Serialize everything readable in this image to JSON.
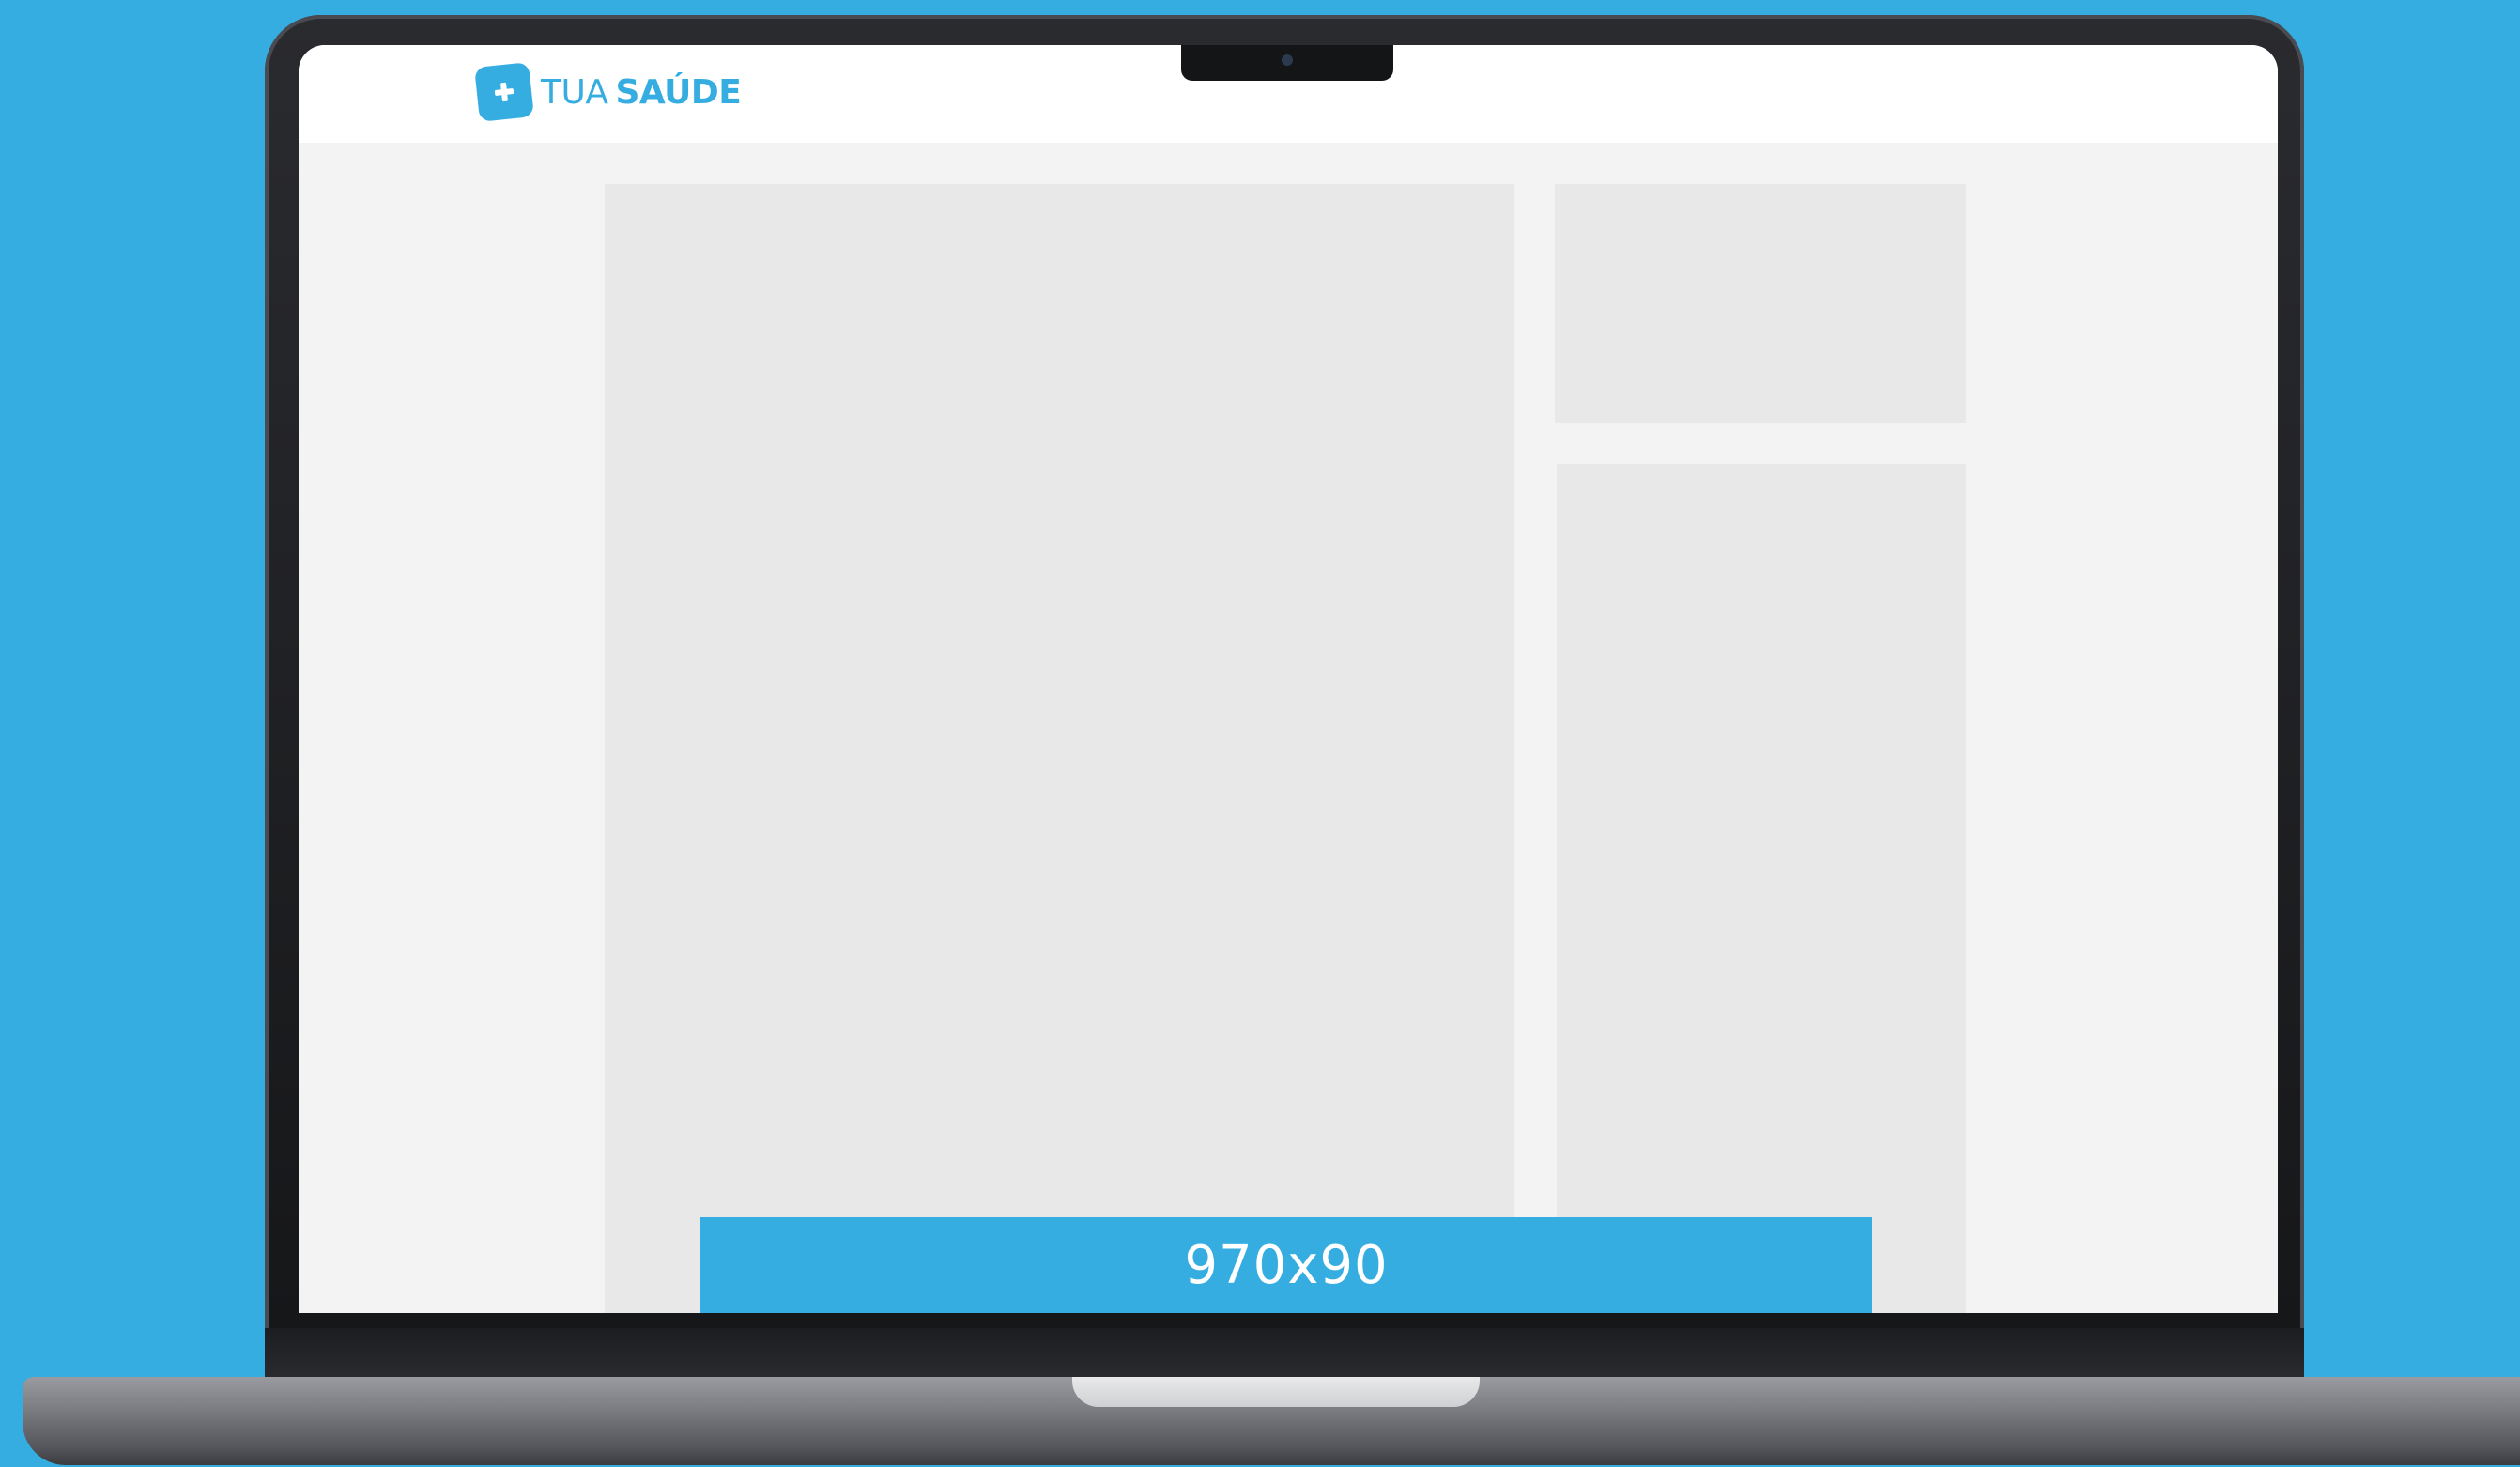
{
  "background_color": "#35ade0",
  "site": {
    "logo": {
      "icon": "plus-icon",
      "text_light": "TUA",
      "text_bold": "SAÚDE",
      "brand_color": "#35ade0"
    }
  },
  "ad_banner": {
    "label": "970x90",
    "color": "#35ade0"
  },
  "placeholder_color": "#e8e8e8"
}
